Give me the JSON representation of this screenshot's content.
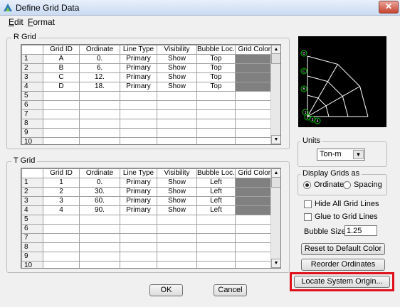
{
  "window": {
    "title": "Define Grid Data",
    "close_icon": "close-icon",
    "app_icon": "etabs-app-icon"
  },
  "menu": [
    {
      "label": "Edit",
      "underline": "E",
      "rest": "dit"
    },
    {
      "label": "Format",
      "underline": "F",
      "rest": "ormat"
    }
  ],
  "r_grid": {
    "label": "R Grid",
    "columns": [
      "",
      "Grid ID",
      "Ordinate",
      "Line Type",
      "Visibility",
      "Bubble Loc.",
      "Grid Color"
    ],
    "rows": [
      [
        "1",
        "A",
        "0.",
        "Primary",
        "Show",
        "Top",
        ""
      ],
      [
        "2",
        "B",
        "6.",
        "Primary",
        "Show",
        "Top",
        ""
      ],
      [
        "3",
        "C",
        "12.",
        "Primary",
        "Show",
        "Top",
        ""
      ],
      [
        "4",
        "D",
        "18.",
        "Primary",
        "Show",
        "Top",
        ""
      ],
      [
        "5",
        "",
        "",
        "",
        "",
        "",
        ""
      ],
      [
        "6",
        "",
        "",
        "",
        "",
        "",
        ""
      ],
      [
        "7",
        "",
        "",
        "",
        "",
        "",
        ""
      ],
      [
        "8",
        "",
        "",
        "",
        "",
        "",
        ""
      ],
      [
        "9",
        "",
        "",
        "",
        "",
        "",
        ""
      ],
      [
        "10",
        "",
        "",
        "",
        "",
        "",
        ""
      ]
    ]
  },
  "t_grid": {
    "label": "T Grid",
    "columns": [
      "",
      "Grid ID",
      "Ordinate",
      "Line Type",
      "Visibility",
      "Bubble Loc.",
      "Grid Color"
    ],
    "rows": [
      [
        "1",
        "1",
        "0.",
        "Primary",
        "Show",
        "Left",
        ""
      ],
      [
        "2",
        "2",
        "30.",
        "Primary",
        "Show",
        "Left",
        ""
      ],
      [
        "3",
        "3",
        "60.",
        "Primary",
        "Show",
        "Left",
        ""
      ],
      [
        "4",
        "4",
        "90.",
        "Primary",
        "Show",
        "Left",
        ""
      ],
      [
        "5",
        "",
        "",
        "",
        "",
        "",
        ""
      ],
      [
        "6",
        "",
        "",
        "",
        "",
        "",
        ""
      ],
      [
        "7",
        "",
        "",
        "",
        "",
        "",
        ""
      ],
      [
        "8",
        "",
        "",
        "",
        "",
        "",
        ""
      ],
      [
        "9",
        "",
        "",
        "",
        "",
        "",
        ""
      ],
      [
        "10",
        "",
        "",
        "",
        "",
        "",
        ""
      ]
    ]
  },
  "grid_color": "#808080",
  "preview": {
    "bubble_labels": [
      "D",
      "C",
      "B",
      "1",
      "2",
      "3",
      "4"
    ],
    "colors": {
      "background": "#000000",
      "lines": "#ffffff",
      "bubbles": "#00c000"
    }
  },
  "units": {
    "label": "Units",
    "value": "Ton-m"
  },
  "display": {
    "label": "Display Grids as",
    "ordinates": "Ordinates",
    "spacing": "Spacing",
    "selected": "Ordinates"
  },
  "hide_lines": {
    "label": "Hide All Grid Lines",
    "checked": false
  },
  "glue_lines": {
    "label": "Glue to Grid Lines",
    "checked": false
  },
  "bubble_size": {
    "label": "Bubble Size",
    "value": "1.25"
  },
  "buttons": {
    "reset_color": "Reset to Default Color",
    "reorder": "Reorder Ordinates",
    "locate_origin": "Locate System Origin...",
    "ok": "OK",
    "cancel": "Cancel"
  },
  "highlight_color": "#e0101a"
}
